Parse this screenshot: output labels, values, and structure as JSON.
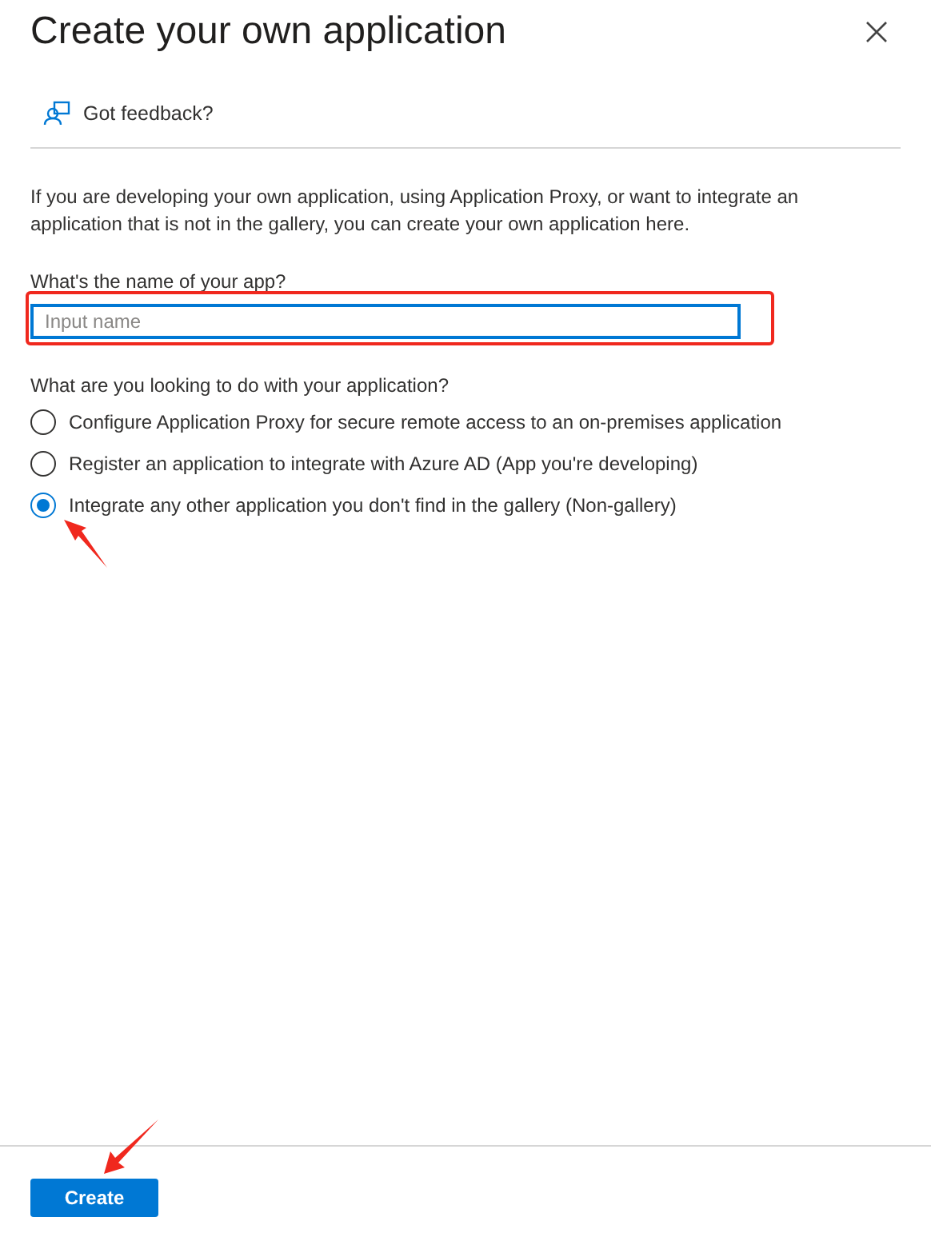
{
  "title": "Create your own application",
  "feedback": {
    "label": "Got feedback?"
  },
  "description": "If you are developing your own application, using Application Proxy, or want to integrate an application that is not in the gallery, you can create your own application here.",
  "name_field": {
    "label": "What's the name of your app?",
    "placeholder": "Input name"
  },
  "question": "What are you looking to do with your application?",
  "options": [
    {
      "label": "Configure Application Proxy for secure remote access to an on-premises application",
      "selected": false
    },
    {
      "label": "Register an application to integrate with Azure AD (App you're developing)",
      "selected": false
    },
    {
      "label": "Integrate any other application you don't find in the gallery (Non-gallery)",
      "selected": true
    }
  ],
  "create_button": "Create"
}
